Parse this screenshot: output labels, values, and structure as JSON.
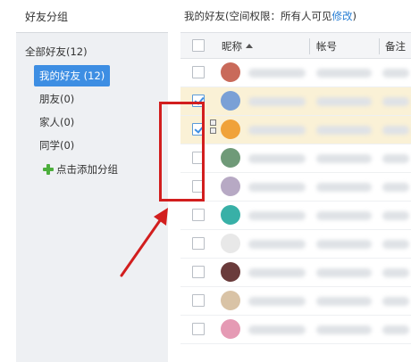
{
  "sidebar": {
    "header": "好友分组",
    "all_label": "全部好友(12)",
    "groups": [
      {
        "label": "我的好友 (12)",
        "active": true
      },
      {
        "label": "朋友(0)",
        "active": false
      },
      {
        "label": "家人(0)",
        "active": false
      },
      {
        "label": "同学(0)",
        "active": false
      }
    ],
    "add_label": "点击添加分组"
  },
  "main": {
    "title_prefix": "我的好友(空间权限：所有人可见",
    "title_link": "修改",
    "title_suffix": ")",
    "columns": {
      "nickname": "昵称",
      "account": "帐号",
      "remark": "备注"
    },
    "rows": [
      {
        "checked": false,
        "avatar_color": "#c96a5a"
      },
      {
        "checked": true,
        "avatar_color": "#7aa0d6"
      },
      {
        "checked": true,
        "avatar_color": "#f0a23a"
      },
      {
        "checked": false,
        "avatar_color": "#6f9a78"
      },
      {
        "checked": false,
        "avatar_color": "#b7a9c4"
      },
      {
        "checked": false,
        "avatar_color": "#38b0a7"
      },
      {
        "checked": false,
        "avatar_color": "#e8e8e8"
      },
      {
        "checked": false,
        "avatar_color": "#6a3b3b"
      },
      {
        "checked": false,
        "avatar_color": "#d9c3a6"
      },
      {
        "checked": false,
        "avatar_color": "#e59ab4"
      }
    ]
  },
  "colors": {
    "accent": "#3d8ee3",
    "selected_row": "#faf1d6",
    "annotation": "#d21e1e"
  }
}
